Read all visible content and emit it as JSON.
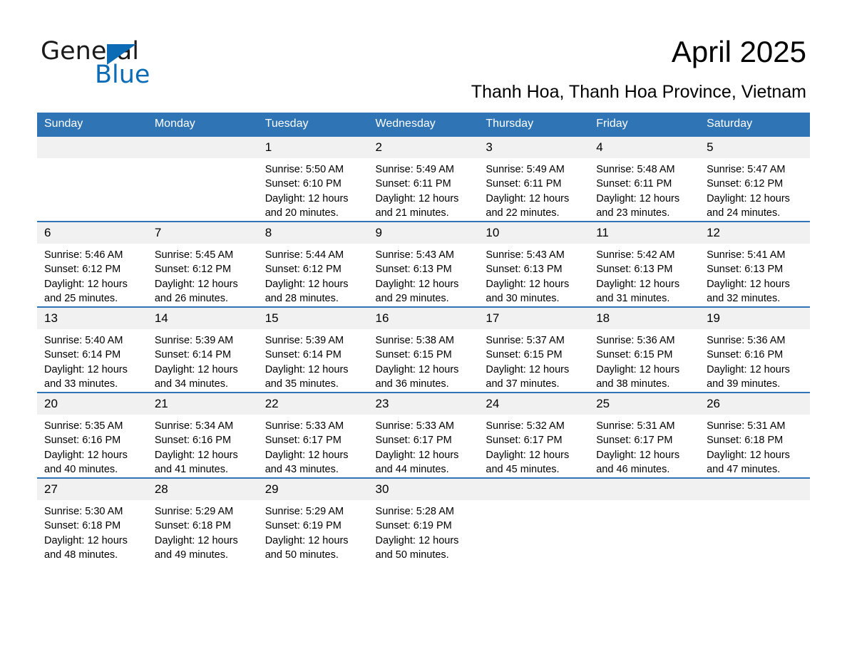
{
  "brand": {
    "name_part1": "General",
    "name_part2": "Blue",
    "triangle_color": "#0b6cb5"
  },
  "header": {
    "title": "April 2025",
    "subtitle": "Thanh Hoa, Thanh Hoa Province, Vietnam"
  },
  "theme": {
    "header_blue": "#2f75b5",
    "daynum_band": "#f1f1f1",
    "row_rule": "#2f75b5"
  },
  "calendar": {
    "weekday_headers": [
      "Sunday",
      "Monday",
      "Tuesday",
      "Wednesday",
      "Thursday",
      "Friday",
      "Saturday"
    ],
    "weeks": [
      [
        {
          "day": "",
          "sunrise": "",
          "sunset": "",
          "daylight_line1": "",
          "daylight_line2": ""
        },
        {
          "day": "",
          "sunrise": "",
          "sunset": "",
          "daylight_line1": "",
          "daylight_line2": ""
        },
        {
          "day": "1",
          "sunrise": "Sunrise: 5:50 AM",
          "sunset": "Sunset: 6:10 PM",
          "daylight_line1": "Daylight: 12 hours",
          "daylight_line2": "and 20 minutes."
        },
        {
          "day": "2",
          "sunrise": "Sunrise: 5:49 AM",
          "sunset": "Sunset: 6:11 PM",
          "daylight_line1": "Daylight: 12 hours",
          "daylight_line2": "and 21 minutes."
        },
        {
          "day": "3",
          "sunrise": "Sunrise: 5:49 AM",
          "sunset": "Sunset: 6:11 PM",
          "daylight_line1": "Daylight: 12 hours",
          "daylight_line2": "and 22 minutes."
        },
        {
          "day": "4",
          "sunrise": "Sunrise: 5:48 AM",
          "sunset": "Sunset: 6:11 PM",
          "daylight_line1": "Daylight: 12 hours",
          "daylight_line2": "and 23 minutes."
        },
        {
          "day": "5",
          "sunrise": "Sunrise: 5:47 AM",
          "sunset": "Sunset: 6:12 PM",
          "daylight_line1": "Daylight: 12 hours",
          "daylight_line2": "and 24 minutes."
        }
      ],
      [
        {
          "day": "6",
          "sunrise": "Sunrise: 5:46 AM",
          "sunset": "Sunset: 6:12 PM",
          "daylight_line1": "Daylight: 12 hours",
          "daylight_line2": "and 25 minutes."
        },
        {
          "day": "7",
          "sunrise": "Sunrise: 5:45 AM",
          "sunset": "Sunset: 6:12 PM",
          "daylight_line1": "Daylight: 12 hours",
          "daylight_line2": "and 26 minutes."
        },
        {
          "day": "8",
          "sunrise": "Sunrise: 5:44 AM",
          "sunset": "Sunset: 6:12 PM",
          "daylight_line1": "Daylight: 12 hours",
          "daylight_line2": "and 28 minutes."
        },
        {
          "day": "9",
          "sunrise": "Sunrise: 5:43 AM",
          "sunset": "Sunset: 6:13 PM",
          "daylight_line1": "Daylight: 12 hours",
          "daylight_line2": "and 29 minutes."
        },
        {
          "day": "10",
          "sunrise": "Sunrise: 5:43 AM",
          "sunset": "Sunset: 6:13 PM",
          "daylight_line1": "Daylight: 12 hours",
          "daylight_line2": "and 30 minutes."
        },
        {
          "day": "11",
          "sunrise": "Sunrise: 5:42 AM",
          "sunset": "Sunset: 6:13 PM",
          "daylight_line1": "Daylight: 12 hours",
          "daylight_line2": "and 31 minutes."
        },
        {
          "day": "12",
          "sunrise": "Sunrise: 5:41 AM",
          "sunset": "Sunset: 6:13 PM",
          "daylight_line1": "Daylight: 12 hours",
          "daylight_line2": "and 32 minutes."
        }
      ],
      [
        {
          "day": "13",
          "sunrise": "Sunrise: 5:40 AM",
          "sunset": "Sunset: 6:14 PM",
          "daylight_line1": "Daylight: 12 hours",
          "daylight_line2": "and 33 minutes."
        },
        {
          "day": "14",
          "sunrise": "Sunrise: 5:39 AM",
          "sunset": "Sunset: 6:14 PM",
          "daylight_line1": "Daylight: 12 hours",
          "daylight_line2": "and 34 minutes."
        },
        {
          "day": "15",
          "sunrise": "Sunrise: 5:39 AM",
          "sunset": "Sunset: 6:14 PM",
          "daylight_line1": "Daylight: 12 hours",
          "daylight_line2": "and 35 minutes."
        },
        {
          "day": "16",
          "sunrise": "Sunrise: 5:38 AM",
          "sunset": "Sunset: 6:15 PM",
          "daylight_line1": "Daylight: 12 hours",
          "daylight_line2": "and 36 minutes."
        },
        {
          "day": "17",
          "sunrise": "Sunrise: 5:37 AM",
          "sunset": "Sunset: 6:15 PM",
          "daylight_line1": "Daylight: 12 hours",
          "daylight_line2": "and 37 minutes."
        },
        {
          "day": "18",
          "sunrise": "Sunrise: 5:36 AM",
          "sunset": "Sunset: 6:15 PM",
          "daylight_line1": "Daylight: 12 hours",
          "daylight_line2": "and 38 minutes."
        },
        {
          "day": "19",
          "sunrise": "Sunrise: 5:36 AM",
          "sunset": "Sunset: 6:16 PM",
          "daylight_line1": "Daylight: 12 hours",
          "daylight_line2": "and 39 minutes."
        }
      ],
      [
        {
          "day": "20",
          "sunrise": "Sunrise: 5:35 AM",
          "sunset": "Sunset: 6:16 PM",
          "daylight_line1": "Daylight: 12 hours",
          "daylight_line2": "and 40 minutes."
        },
        {
          "day": "21",
          "sunrise": "Sunrise: 5:34 AM",
          "sunset": "Sunset: 6:16 PM",
          "daylight_line1": "Daylight: 12 hours",
          "daylight_line2": "and 41 minutes."
        },
        {
          "day": "22",
          "sunrise": "Sunrise: 5:33 AM",
          "sunset": "Sunset: 6:17 PM",
          "daylight_line1": "Daylight: 12 hours",
          "daylight_line2": "and 43 minutes."
        },
        {
          "day": "23",
          "sunrise": "Sunrise: 5:33 AM",
          "sunset": "Sunset: 6:17 PM",
          "daylight_line1": "Daylight: 12 hours",
          "daylight_line2": "and 44 minutes."
        },
        {
          "day": "24",
          "sunrise": "Sunrise: 5:32 AM",
          "sunset": "Sunset: 6:17 PM",
          "daylight_line1": "Daylight: 12 hours",
          "daylight_line2": "and 45 minutes."
        },
        {
          "day": "25",
          "sunrise": "Sunrise: 5:31 AM",
          "sunset": "Sunset: 6:17 PM",
          "daylight_line1": "Daylight: 12 hours",
          "daylight_line2": "and 46 minutes."
        },
        {
          "day": "26",
          "sunrise": "Sunrise: 5:31 AM",
          "sunset": "Sunset: 6:18 PM",
          "daylight_line1": "Daylight: 12 hours",
          "daylight_line2": "and 47 minutes."
        }
      ],
      [
        {
          "day": "27",
          "sunrise": "Sunrise: 5:30 AM",
          "sunset": "Sunset: 6:18 PM",
          "daylight_line1": "Daylight: 12 hours",
          "daylight_line2": "and 48 minutes."
        },
        {
          "day": "28",
          "sunrise": "Sunrise: 5:29 AM",
          "sunset": "Sunset: 6:18 PM",
          "daylight_line1": "Daylight: 12 hours",
          "daylight_line2": "and 49 minutes."
        },
        {
          "day": "29",
          "sunrise": "Sunrise: 5:29 AM",
          "sunset": "Sunset: 6:19 PM",
          "daylight_line1": "Daylight: 12 hours",
          "daylight_line2": "and 50 minutes."
        },
        {
          "day": "30",
          "sunrise": "Sunrise: 5:28 AM",
          "sunset": "Sunset: 6:19 PM",
          "daylight_line1": "Daylight: 12 hours",
          "daylight_line2": "and 50 minutes."
        },
        {
          "day": "",
          "sunrise": "",
          "sunset": "",
          "daylight_line1": "",
          "daylight_line2": ""
        },
        {
          "day": "",
          "sunrise": "",
          "sunset": "",
          "daylight_line1": "",
          "daylight_line2": ""
        },
        {
          "day": "",
          "sunrise": "",
          "sunset": "",
          "daylight_line1": "",
          "daylight_line2": ""
        }
      ]
    ]
  }
}
